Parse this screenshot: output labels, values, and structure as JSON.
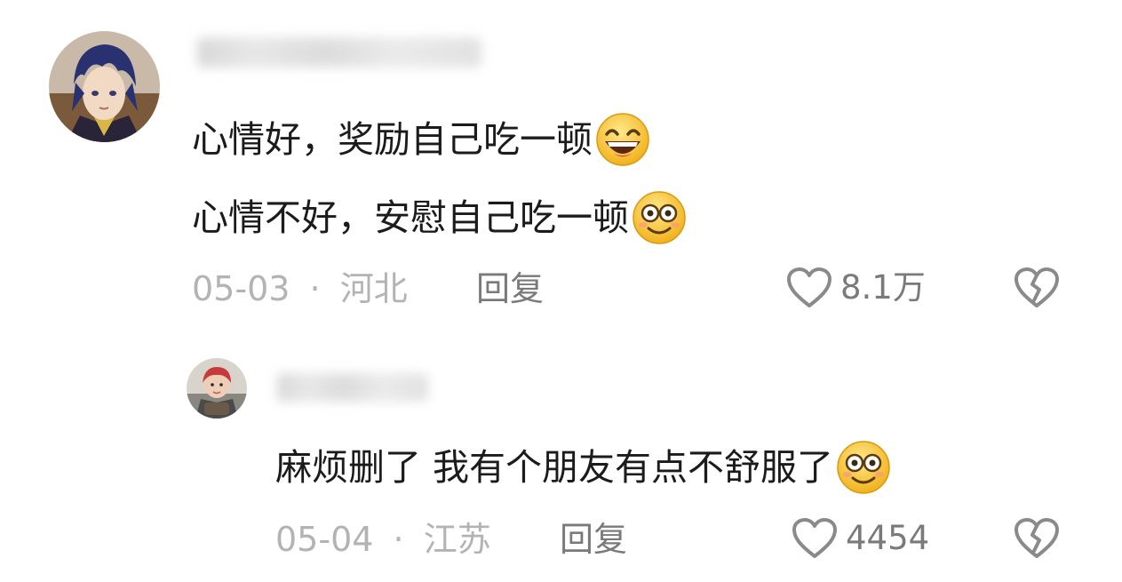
{
  "comments": [
    {
      "username": "",
      "lines": [
        "心情好，奖励自己吃一顿",
        "心情不好，安慰自己吃一顿"
      ],
      "emojis": [
        "grin-emoji",
        "smile-emoji"
      ],
      "date": "05-03",
      "separator": "·",
      "location": "河北",
      "reply_label": "回复",
      "likes": "8.1万"
    }
  ],
  "replies": [
    {
      "username": "",
      "text": "麻烦删了 我有个朋友有点不舒服了",
      "emoji": "smile-emoji",
      "date": "05-04",
      "separator": "·",
      "location": "江苏",
      "reply_label": "回复",
      "likes": "4454"
    }
  ],
  "icons": {
    "like": "heart-outline-icon",
    "dislike": "broken-heart-icon"
  },
  "colors": {
    "text": "#1b1b1b",
    "meta": "#b3b3b3",
    "action": "#7a7a7a"
  }
}
